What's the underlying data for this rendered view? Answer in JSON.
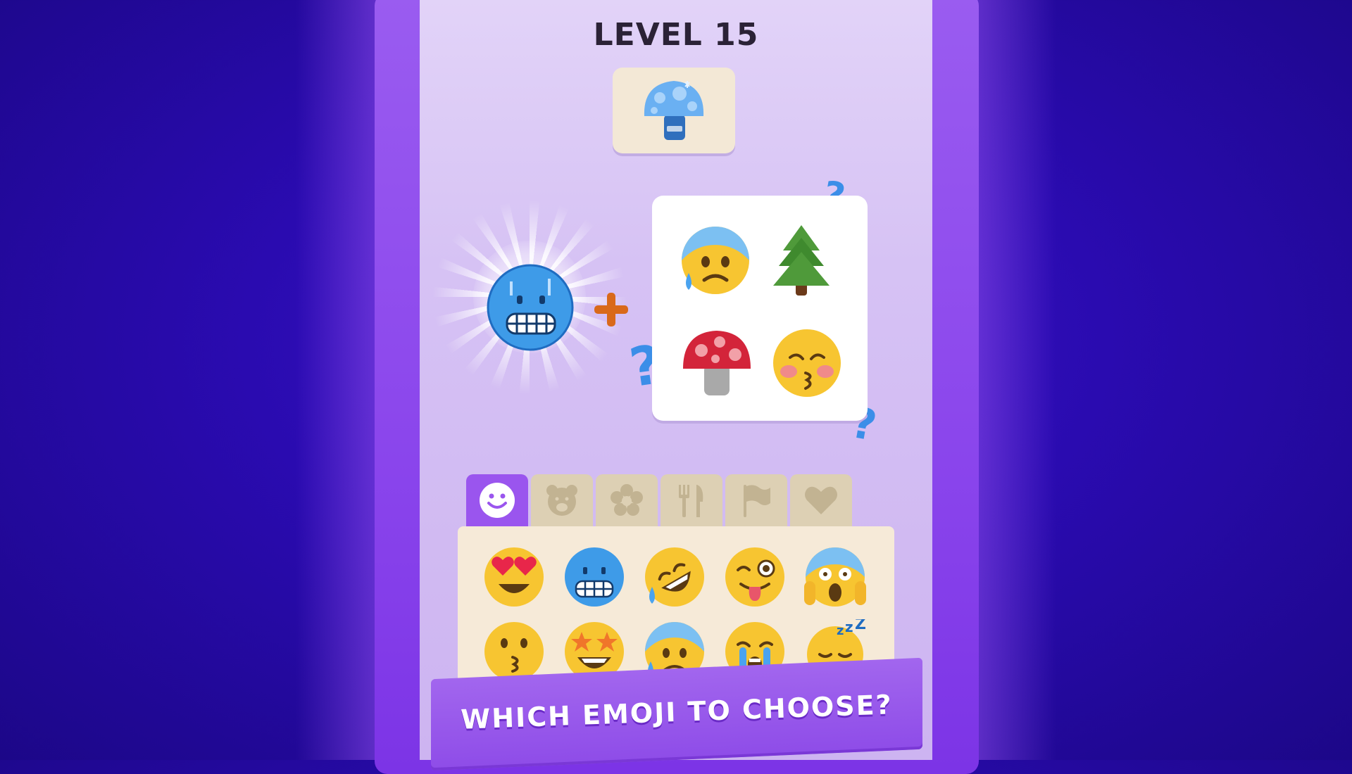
{
  "level": {
    "title": "LEVEL 15"
  },
  "target": {
    "emoji": "frozen-mushroom"
  },
  "selected": {
    "emoji": "cold-face"
  },
  "choices": [
    "anxious-face-with-sweat",
    "evergreen-tree",
    "mushroom",
    "kissing-face-with-closed-eyes"
  ],
  "tabs": [
    {
      "icon": "smiley-icon",
      "active": true
    },
    {
      "icon": "bear-icon",
      "active": false
    },
    {
      "icon": "flower-icon",
      "active": false
    },
    {
      "icon": "fork-knife-icon",
      "active": false
    },
    {
      "icon": "flag-icon",
      "active": false
    },
    {
      "icon": "heart-icon",
      "active": false
    }
  ],
  "picker_rows": [
    [
      "heart-eyes",
      "cold-face",
      "rolling-laughing",
      "winking-tongue",
      "screaming-in-fear"
    ],
    [
      "kissing-face",
      "star-struck",
      "anxious-face-with-sweat",
      "loudly-crying",
      "sleeping-face"
    ]
  ],
  "banner": {
    "text": "WHICH EMOJI TO CHOOSE?"
  },
  "colors": {
    "background": "#2a0bb0",
    "frame": "#8a45ec",
    "accent": "#9a55ee",
    "plus": "#d9691a",
    "question": "#3b8ee8"
  }
}
